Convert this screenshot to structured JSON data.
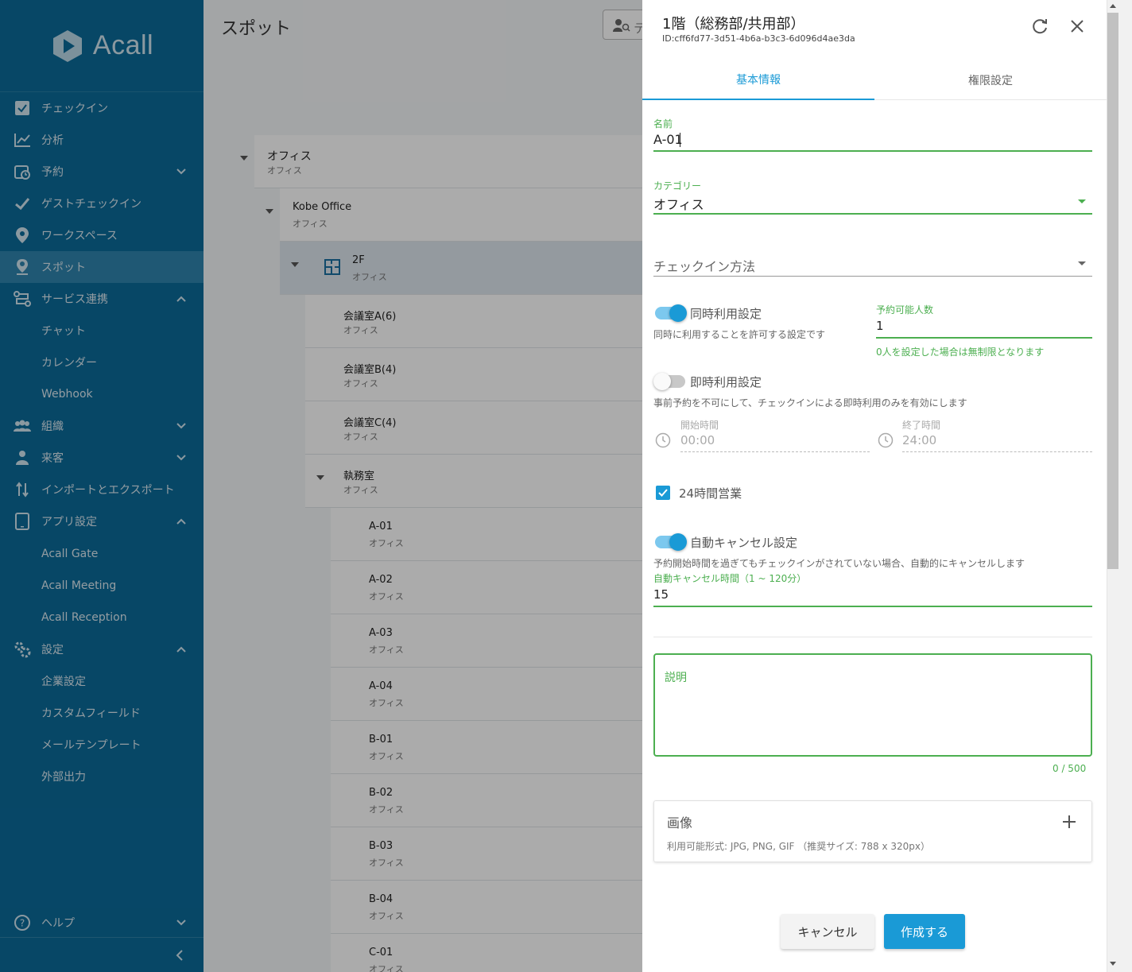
{
  "sidebar": {
    "brand": "Acall",
    "items": [
      {
        "label": "チェックイン",
        "icon": "checkbox-icon",
        "chevron": ""
      },
      {
        "label": "分析",
        "icon": "chart-line-icon",
        "chevron": ""
      },
      {
        "label": "予約",
        "icon": "calendar-clock-icon",
        "chevron": "down"
      },
      {
        "label": "ゲストチェックイン",
        "icon": "check-icon",
        "chevron": ""
      },
      {
        "label": "ワークスペース",
        "icon": "map-pin-icon",
        "chevron": ""
      },
      {
        "label": "スポット",
        "icon": "person-pin-icon",
        "chevron": "",
        "active": true
      },
      {
        "label": "サービス連携",
        "icon": "integration-icon",
        "chevron": "up"
      },
      {
        "label": "組織",
        "icon": "group-icon",
        "chevron": "down"
      },
      {
        "label": "来客",
        "icon": "visitor-icon",
        "chevron": "down"
      },
      {
        "label": "インポートとエクスポート",
        "icon": "import-export-icon",
        "chevron": ""
      },
      {
        "label": "アプリ設定",
        "icon": "tablet-icon",
        "chevron": "up"
      },
      {
        "label": "設定",
        "icon": "gears-icon",
        "chevron": "up"
      },
      {
        "label": "ヘルプ",
        "icon": "help-circle-icon",
        "chevron": "down"
      }
    ],
    "sub_service": [
      "チャット",
      "カレンダー",
      "Webhook"
    ],
    "sub_app": [
      "Acall Gate",
      "Acall Meeting",
      "Acall Reception"
    ],
    "sub_settings": [
      "企業設定",
      "カスタムフィールド",
      "メールテンプレート",
      "外部出力"
    ]
  },
  "main": {
    "page_title": "スポット",
    "search_placeholder": "テ",
    "tree": [
      {
        "name": "オフィス",
        "category": "オフィス"
      },
      {
        "name": "Kobe Office",
        "category": "オフィス"
      },
      {
        "name": "2F",
        "category": "オフィス"
      },
      {
        "name": "会議室A(6)",
        "category": "オフィス"
      },
      {
        "name": "会議室B(4)",
        "category": "オフィス"
      },
      {
        "name": "会議室C(4)",
        "category": "オフィス"
      },
      {
        "name": "執務室",
        "category": "オフィス"
      },
      {
        "name": "A-01",
        "category": "オフィス"
      },
      {
        "name": "A-02",
        "category": "オフィス"
      },
      {
        "name": "A-03",
        "category": "オフィス"
      },
      {
        "name": "A-04",
        "category": "オフィス"
      },
      {
        "name": "B-01",
        "category": "オフィス"
      },
      {
        "name": "B-02",
        "category": "オフィス"
      },
      {
        "name": "B-03",
        "category": "オフィス"
      },
      {
        "name": "B-04",
        "category": "オフィス"
      },
      {
        "name": "C-01",
        "category": "オフィス"
      }
    ]
  },
  "drawer": {
    "title": "1階（総務部/共用部）",
    "id_text": "ID:cff6fd77-3d51-4b6a-b3c3-6d096d4ae3da",
    "tabs": [
      "基本情報",
      "権限設定"
    ],
    "name_label": "名前",
    "name_value": "A-01",
    "category_label": "カテゴリー",
    "category_value": "オフィス",
    "checkin_method_placeholder": "チェックイン方法",
    "simultaneous": {
      "label": "同時利用設定",
      "hint": "同時に利用することを許可する設定です",
      "enabled": true,
      "capacity_label": "予約可能人数",
      "capacity_value": "1",
      "capacity_hint": "0人を設定した場合は無制限となります"
    },
    "instant": {
      "label": "即時利用設定",
      "hint": "事前予約を不可にして、チェックインによる即時利用のみを有効にします",
      "enabled": false,
      "start_label": "開始時間",
      "start_value": "00:00",
      "end_label": "終了時間",
      "end_value": "24:00"
    },
    "open_24h": {
      "label": "24時間営業",
      "checked": true
    },
    "auto_cancel": {
      "label": "自動キャンセル設定",
      "hint": "予約開始時間を過ぎてもチェックインがされていない場合、自動的にキャンセルします",
      "enabled": true,
      "minutes_label": "自動キャンセル時間（1 ~ 120分）",
      "minutes_value": "15"
    },
    "description": {
      "label": "説明",
      "counter": "0 / 500"
    },
    "image": {
      "title": "画像",
      "hint": "利用可能形式: JPG, PNG, GIF （推奨サイズ: 788 x 320px）"
    },
    "buttons": {
      "cancel": "キャンセル",
      "create": "作成する"
    }
  },
  "colors": {
    "sidebar": "#0b6a99",
    "accent": "#1a9ad6",
    "success": "#4caf50"
  }
}
